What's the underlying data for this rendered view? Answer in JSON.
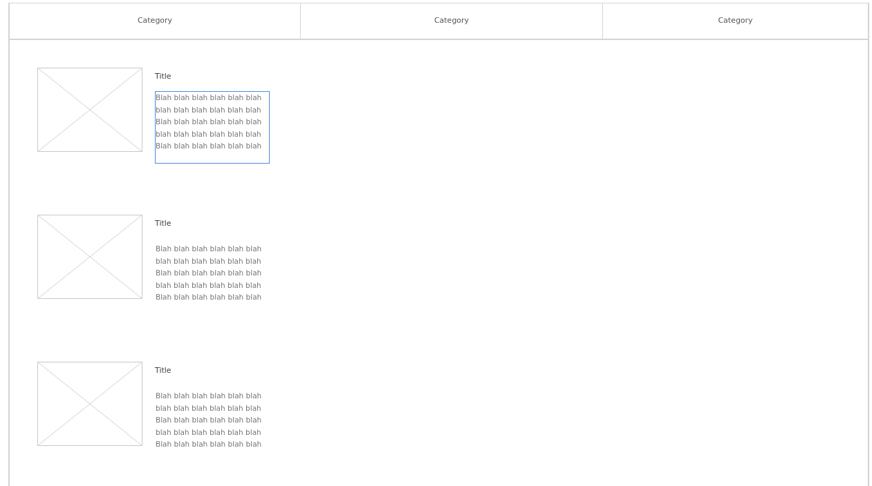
{
  "tabs": [
    {
      "label": "Category",
      "selected": false
    },
    {
      "label": "Category",
      "selected": false
    },
    {
      "label": "Category",
      "selected": false
    }
  ],
  "items": [
    {
      "title": "Title",
      "lines": [
        "Blah blah blah blah blah blah",
        "blah blah blah blah blah blah",
        "Blah blah blah blah blah blah",
        "blah blah blah blah blah blah",
        "Blah blah blah blah blah blah"
      ],
      "selected": true
    },
    {
      "title": "Title",
      "lines": [
        "Blah blah blah blah blah blah",
        "blah blah blah blah blah blah",
        "Blah blah blah blah blah blah",
        "blah blah blah blah blah blah",
        "Blah blah blah blah blah blah"
      ],
      "selected": false
    },
    {
      "title": "Title",
      "lines": [
        "Blah blah blah blah blah blah",
        "blah blah blah blah blah blah",
        "Blah blah blah blah blah blah",
        "blah blah blah blah blah blah",
        "Blah blah blah blah blah blah"
      ],
      "selected": false
    }
  ]
}
